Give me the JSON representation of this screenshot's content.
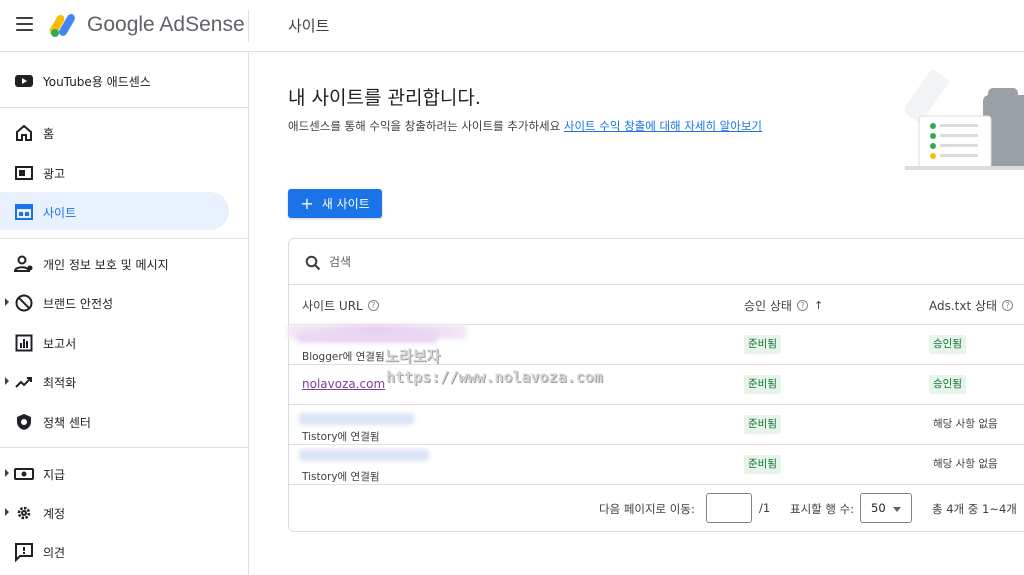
{
  "app": {
    "brand_google": "Google",
    "brand_product": "AdSense",
    "page_title": "사이트"
  },
  "sidebar": {
    "top_item": {
      "label": "YouTube용 애드센스",
      "icon": "youtube-icon"
    },
    "items": [
      {
        "label": "홈",
        "icon": "home-icon",
        "has_arrow": false
      },
      {
        "label": "광고",
        "icon": "ads-icon",
        "has_arrow": false
      },
      {
        "label": "사이트",
        "icon": "sites-icon",
        "has_arrow": false,
        "active": true
      },
      {
        "label": "개인 정보 보호 및 메시지",
        "icon": "privacy-icon",
        "has_arrow": false
      },
      {
        "label": "브랜드 안전성",
        "icon": "block-icon",
        "has_arrow": true
      },
      {
        "label": "보고서",
        "icon": "reports-icon",
        "has_arrow": false
      },
      {
        "label": "최적화",
        "icon": "trending-icon",
        "has_arrow": true
      },
      {
        "label": "정책 센터",
        "icon": "policy-icon",
        "has_arrow": false
      },
      {
        "label": "지급",
        "icon": "payments-icon",
        "has_arrow": true
      },
      {
        "label": "계정",
        "icon": "gear-icon",
        "has_arrow": true
      },
      {
        "label": "의견",
        "icon": "feedback-icon",
        "has_arrow": false
      }
    ]
  },
  "main": {
    "title": "내 사이트를 관리합니다.",
    "description": "애드센스를 통해 수익을 창출하려는 사이트를 추가하세요",
    "learn_more_link": "사이트 수익 창출에 대해 자세히 알아보기",
    "new_site_button": "새 사이트"
  },
  "table": {
    "search_placeholder": "검색",
    "columns": {
      "site_url": "사이트 URL",
      "approval_status": "승인 상태",
      "ads_txt_status": "Ads.txt 상태"
    },
    "rows": [
      {
        "site": "",
        "sub": "Blogger에 연결됨",
        "approval": "준비됨",
        "ads_txt": "승인됨",
        "ads_txt_style": "green"
      },
      {
        "site": "nolavoza.com",
        "sub": "",
        "approval": "준비됨",
        "ads_txt": "승인됨",
        "ads_txt_style": "green"
      },
      {
        "site": "",
        "sub": "Tistory에 연결됨",
        "approval": "준비됨",
        "ads_txt": "해당 사항 없음",
        "ads_txt_style": "plain"
      },
      {
        "site": "",
        "sub": "Tistory에 연결됨",
        "approval": "준비됨",
        "ads_txt": "해당 사항 없음",
        "ads_txt_style": "plain"
      }
    ],
    "footer": {
      "goto_label": "다음 페이지로 이동:",
      "page_input_value": "",
      "page_total": "/1",
      "rows_label": "표시할 행 수:",
      "rows_value": "50",
      "range_text": "총 4개 중 1~4개"
    }
  },
  "watermark": {
    "line1": "노라보자",
    "line2": "https://www.nolavoza.com"
  },
  "colors": {
    "accent": "#1a73e8",
    "active_bg": "#e8f0fe",
    "green_chip_bg": "#e6f4ea",
    "green_chip_text": "#137333",
    "link_visited": "#7b3f9e"
  }
}
